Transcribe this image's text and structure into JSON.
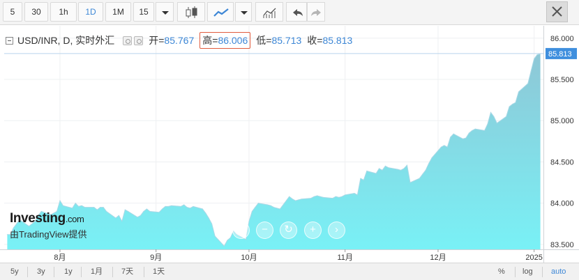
{
  "toolbar": {
    "intervals": [
      "5",
      "30",
      "1h",
      "1D",
      "1M",
      "15"
    ],
    "active_interval": "1D",
    "colors": {
      "active": "#3d87d6"
    }
  },
  "legend": {
    "symbol": "USD/INR, D, 实时外汇",
    "open_label": "开=",
    "open": "85.767",
    "high_label": "高=",
    "high": "86.006",
    "low_label": "低=",
    "low": "85.713",
    "close_label": "收=",
    "close": "85.813"
  },
  "branding": {
    "main": "Investing",
    "suffix": ".com",
    "sub": "由TradingView提供"
  },
  "nav_buttons": [
    "‹",
    "−",
    "↻",
    "+",
    "›"
  ],
  "bottom": {
    "ranges": [
      "5y",
      "3y",
      "1y",
      "1月",
      "7天",
      "1天"
    ],
    "scales": {
      "percent": "%",
      "log": "log",
      "auto": "auto"
    }
  },
  "chart_data": {
    "type": "area",
    "series": [
      {
        "x": [
          "2024-07-15",
          "2024-07-16",
          "2024-07-17",
          "2024-07-18",
          "2024-07-19",
          "2024-07-22",
          "2024-07-23",
          "2024-07-24",
          "2024-07-25",
          "2024-07-26",
          "2024-07-29",
          "2024-07-30",
          "2024-07-31",
          "2024-08-01",
          "2024-08-02",
          "2024-08-05",
          "2024-08-06",
          "2024-08-07",
          "2024-08-08",
          "2024-08-09",
          "2024-08-12",
          "2024-08-13",
          "2024-08-14",
          "2024-08-15",
          "2024-08-16",
          "2024-08-19",
          "2024-08-20",
          "2024-08-21",
          "2024-08-22",
          "2024-08-23",
          "2024-08-26",
          "2024-08-27",
          "2024-08-28",
          "2024-08-29",
          "2024-08-30",
          "2024-09-02",
          "2024-09-03",
          "2024-09-04",
          "2024-09-05",
          "2024-09-06",
          "2024-09-09",
          "2024-09-10",
          "2024-09-11",
          "2024-09-12",
          "2024-09-13",
          "2024-09-16",
          "2024-09-17",
          "2024-09-18",
          "2024-09-19",
          "2024-09-20",
          "2024-09-23",
          "2024-09-24",
          "2024-09-25",
          "2024-09-26",
          "2024-09-27",
          "2024-09-30",
          "2024-10-01",
          "2024-10-02",
          "2024-10-03",
          "2024-10-04",
          "2024-10-07",
          "2024-10-08",
          "2024-10-09",
          "2024-10-10",
          "2024-10-11",
          "2024-10-14",
          "2024-10-15",
          "2024-10-16",
          "2024-10-17",
          "2024-10-18",
          "2024-10-21",
          "2024-10-22",
          "2024-10-23",
          "2024-10-24",
          "2024-10-25",
          "2024-10-28",
          "2024-10-29",
          "2024-10-30",
          "2024-10-31",
          "2024-11-01",
          "2024-11-04",
          "2024-11-05",
          "2024-11-06",
          "2024-11-07",
          "2024-11-08",
          "2024-11-11",
          "2024-11-12",
          "2024-11-13",
          "2024-11-14",
          "2024-11-15",
          "2024-11-18",
          "2024-11-19",
          "2024-11-20",
          "2024-11-21",
          "2024-11-22",
          "2024-11-25",
          "2024-11-26",
          "2024-11-27",
          "2024-11-28",
          "2024-11-29",
          "2024-12-02",
          "2024-12-03",
          "2024-12-04",
          "2024-12-05",
          "2024-12-06",
          "2024-12-09",
          "2024-12-10",
          "2024-12-11",
          "2024-12-12",
          "2024-12-13",
          "2024-12-16",
          "2024-12-17",
          "2024-12-18",
          "2024-12-19",
          "2024-12-20",
          "2024-12-23",
          "2024-12-24",
          "2024-12-25",
          "2024-12-26",
          "2024-12-27",
          "2024-12-30",
          "2024-12-31",
          "2025-01-01",
          "2025-01-02",
          "2025-01-03"
        ],
        "values": [
          83.62,
          83.62,
          83.7,
          83.75,
          83.8,
          83.72,
          83.75,
          83.78,
          83.85,
          83.9,
          83.86,
          83.88,
          83.9,
          84.03,
          83.97,
          83.94,
          84.0,
          83.96,
          83.97,
          83.95,
          83.95,
          83.92,
          83.95,
          83.95,
          83.9,
          83.82,
          83.85,
          83.78,
          83.92,
          83.9,
          83.83,
          83.85,
          83.9,
          83.93,
          83.9,
          83.89,
          83.93,
          83.96,
          83.96,
          83.97,
          83.96,
          83.98,
          83.95,
          83.94,
          83.96,
          83.93,
          83.88,
          83.82,
          83.75,
          83.6,
          83.48,
          83.55,
          83.58,
          83.66,
          83.62,
          83.56,
          83.78,
          83.9,
          83.95,
          84.0,
          83.98,
          83.97,
          83.95,
          83.94,
          83.93,
          84.08,
          84.05,
          84.03,
          84.04,
          84.05,
          84.06,
          84.08,
          84.09,
          84.08,
          84.07,
          84.06,
          84.08,
          84.07,
          84.08,
          84.1,
          84.12,
          84.1,
          84.3,
          84.28,
          84.39,
          84.36,
          84.42,
          84.4,
          84.45,
          84.43,
          84.41,
          84.4,
          84.42,
          84.46,
          84.25,
          84.3,
          84.35,
          84.4,
          84.48,
          84.55,
          84.68,
          84.7,
          84.68,
          84.8,
          84.84,
          84.78,
          84.79,
          84.85,
          84.88,
          84.9,
          84.88,
          84.96,
          85.1,
          85.05,
          84.97,
          85.05,
          85.17,
          85.2,
          85.22,
          85.35,
          85.45,
          85.6,
          85.75,
          85.8,
          85.81
        ]
      }
    ],
    "xticks": [
      "8月",
      "9月",
      "10月",
      "11月",
      "12月",
      "2025"
    ],
    "xtick_dates": [
      "2024-08-01",
      "2024-09-01",
      "2024-10-01",
      "2024-11-01",
      "2024-12-01",
      "2025-01-01"
    ],
    "yticks": [
      83.5,
      84.0,
      84.5,
      85.0,
      85.5,
      86.0
    ],
    "ylim": [
      83.44,
      86.15
    ],
    "xlim": [
      "2024-07-14",
      "2025-01-04"
    ],
    "last_price_label": "85.813",
    "last_value": 85.813,
    "colors": {
      "fill_top": "#8ec7d6",
      "fill_bottom": "#79f1f6",
      "line": "#a8d8e6",
      "last_price": "#3f8fde"
    },
    "grid": true
  }
}
